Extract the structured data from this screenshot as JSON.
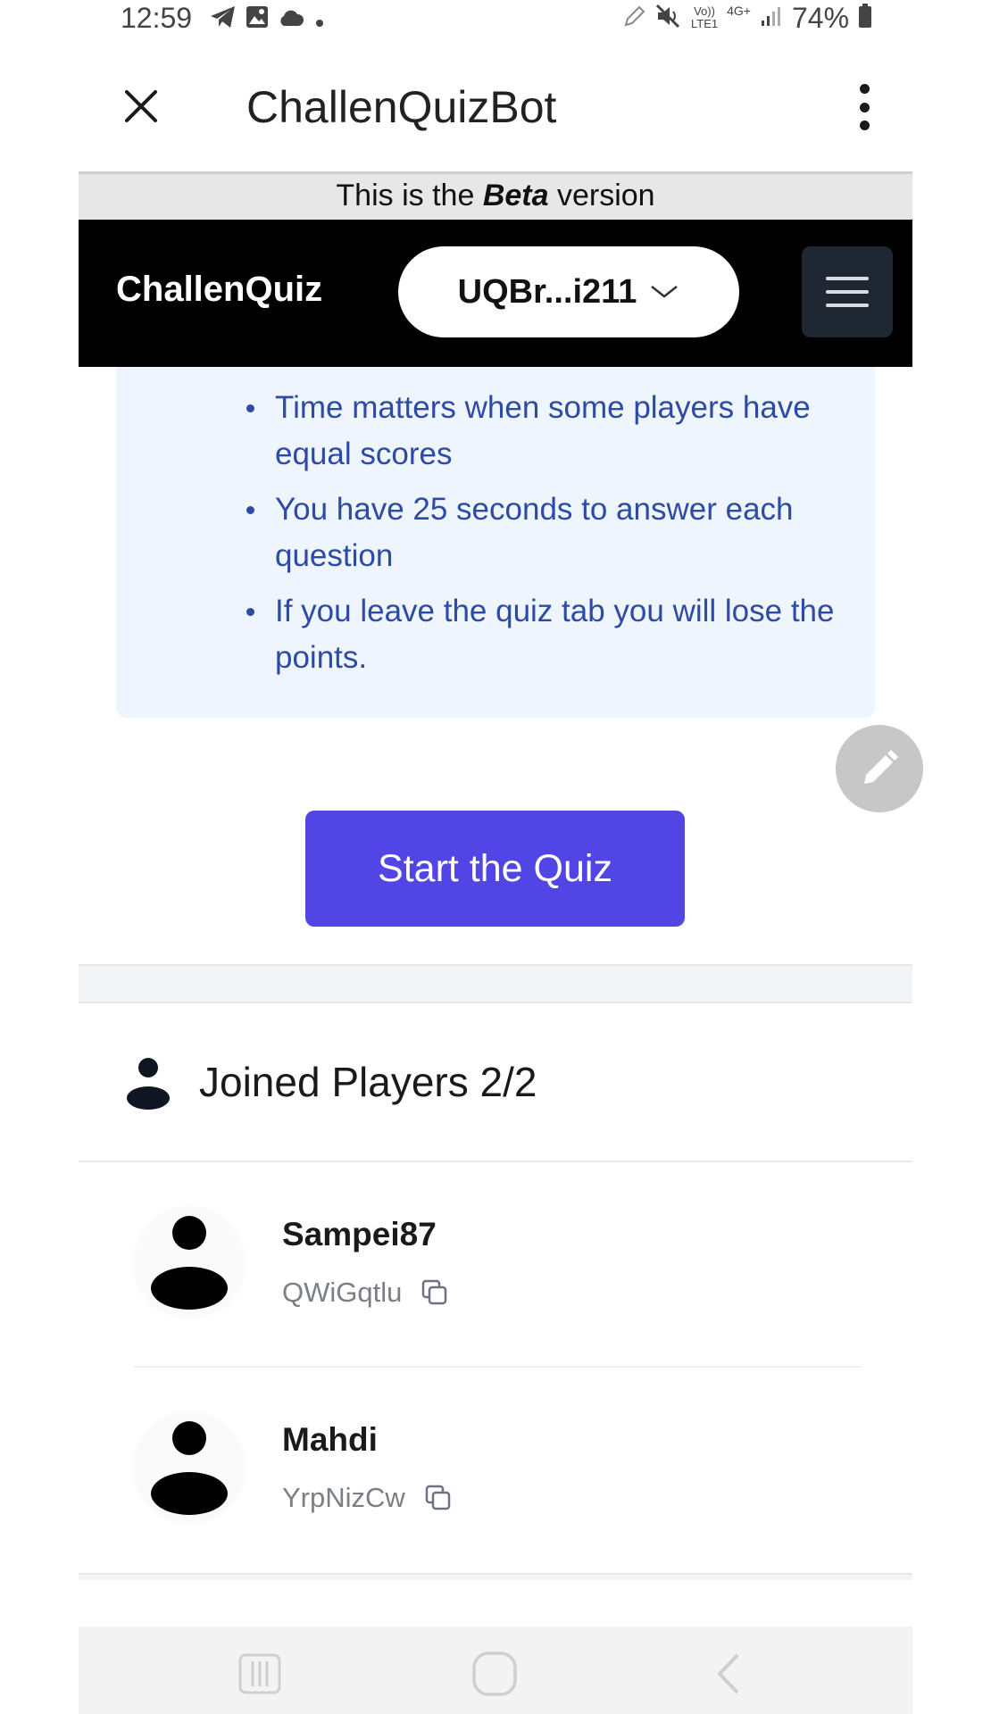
{
  "status_bar": {
    "time": "12:59",
    "battery": "74%",
    "network_top": "Vo))",
    "network_bottom": "LTE1",
    "net_type": "4G+",
    "icons_left": [
      "telegram-icon",
      "image-icon",
      "cloud-icon",
      "dot-icon"
    ],
    "icons_right": [
      "pen-icon",
      "mute-icon",
      "signal-icon",
      "battery-icon"
    ]
  },
  "telegram_header": {
    "title": "ChallenQuizBot"
  },
  "beta_banner": {
    "prefix": "This is the",
    "emphasis": "Beta",
    "suffix": "version"
  },
  "app_bar": {
    "brand": "ChallenQuiz",
    "wallet": "UQBr...i211"
  },
  "rules": [
    "Time matters when some players have equal scores",
    "You have 25 seconds to answer each question",
    "If you leave the quiz tab you will lose the points."
  ],
  "start_button": {
    "label": "Start the Quiz"
  },
  "players": {
    "title": "Joined Players 2/2",
    "list": [
      {
        "name": "Sampei87",
        "id": "QWiGqtlu"
      },
      {
        "name": "Mahdi",
        "id": "YrpNizCw"
      }
    ]
  },
  "colors": {
    "accent": "#5146e5",
    "rules_text": "#2d4aa6",
    "rules_bg": "#eef5fc",
    "app_bar": "#000000"
  }
}
